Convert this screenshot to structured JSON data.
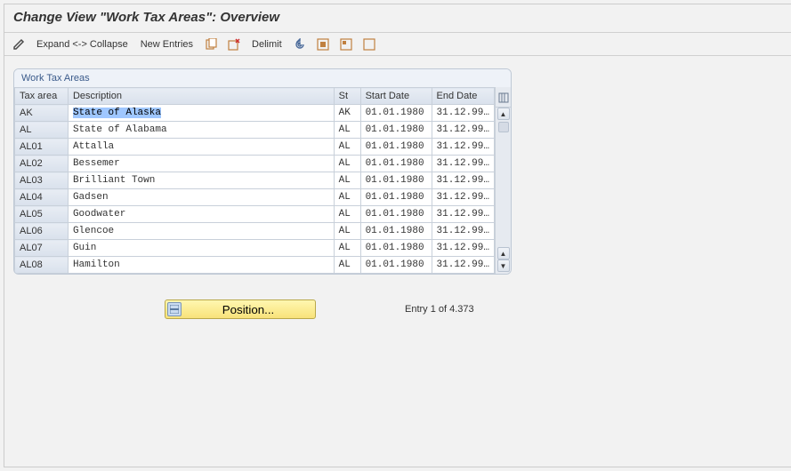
{
  "title": "Change View \"Work Tax Areas\": Overview",
  "toolbar": {
    "expand": "Expand <-> Collapse",
    "new_entries": "New Entries",
    "delimit": "Delimit"
  },
  "panel": {
    "title": "Work Tax Areas"
  },
  "columns": {
    "tax_area": "Tax area",
    "description": "Description",
    "st": "St",
    "start_date": "Start Date",
    "end_date": "End Date"
  },
  "rows": [
    {
      "tax": "AK",
      "desc": "State of Alaska",
      "st": "AK",
      "start": "01.01.1980",
      "end": "31.12.99…",
      "selected": true
    },
    {
      "tax": "AL",
      "desc": "State of Alabama",
      "st": "AL",
      "start": "01.01.1980",
      "end": "31.12.99…",
      "selected": false
    },
    {
      "tax": "AL01",
      "desc": "Attalla",
      "st": "AL",
      "start": "01.01.1980",
      "end": "31.12.99…",
      "selected": false
    },
    {
      "tax": "AL02",
      "desc": "Bessemer",
      "st": "AL",
      "start": "01.01.1980",
      "end": "31.12.99…",
      "selected": false
    },
    {
      "tax": "AL03",
      "desc": "Brilliant Town",
      "st": "AL",
      "start": "01.01.1980",
      "end": "31.12.99…",
      "selected": false
    },
    {
      "tax": "AL04",
      "desc": "Gadsen",
      "st": "AL",
      "start": "01.01.1980",
      "end": "31.12.99…",
      "selected": false
    },
    {
      "tax": "AL05",
      "desc": "Goodwater",
      "st": "AL",
      "start": "01.01.1980",
      "end": "31.12.99…",
      "selected": false
    },
    {
      "tax": "AL06",
      "desc": "Glencoe",
      "st": "AL",
      "start": "01.01.1980",
      "end": "31.12.99…",
      "selected": false
    },
    {
      "tax": "AL07",
      "desc": "Guin",
      "st": "AL",
      "start": "01.01.1980",
      "end": "31.12.99…",
      "selected": false
    },
    {
      "tax": "AL08",
      "desc": "Hamilton",
      "st": "AL",
      "start": "01.01.1980",
      "end": "31.12.99…",
      "selected": false
    }
  ],
  "footer": {
    "position_label": "Position...",
    "entry_text": "Entry 1 of 4.373"
  }
}
